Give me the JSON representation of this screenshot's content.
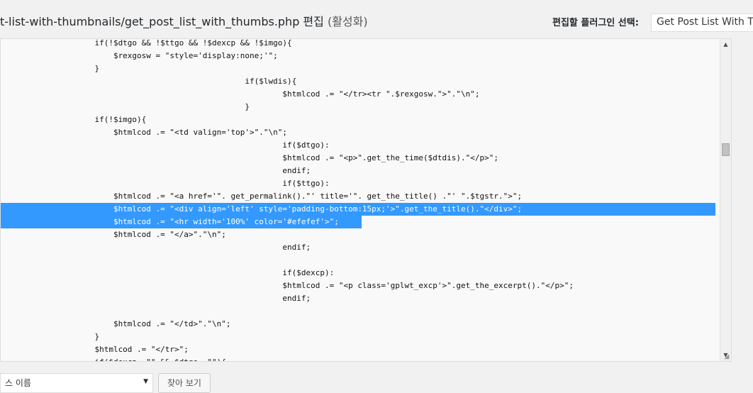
{
  "header": {
    "file_title": "t-list-with-thumbnails/get_post_list_with_thumbs.php 편집",
    "file_status": "(활성화)",
    "plugin_select_label": "편집할 플러그인 선택:",
    "plugin_select_value": "Get Post List With Thumbs"
  },
  "editor": {
    "lines": [
      "                    if(!$dtgo && !$ttgo && !$dexcp && !$imgo){",
      "                        $rexgosw = \"style='display:none;'\";",
      "                    }",
      "                                                    if($lwdis){",
      "                                                            $htmlcod .= \"</tr><tr \".$rexgosw.\">\".\"\\n\";",
      "                                                    }",
      "                    if(!$imgo){",
      "                        $htmlcod .= \"<td valign='top'>\".\"\\n\";",
      "                                                            if($dtgo):",
      "                                                            $htmlcod .= \"<p>\".get_the_time($dtdis).\"</p>\";",
      "                                                            endif;",
      "                                                            if($ttgo):",
      "                        $htmlcod .= \"<a href='\". get_permalink().\"' title='\". get_the_title() .\"' \".$tgstr.\">\";",
      "                        $htmlcod .= \"<div align='left' style='padding-bottom:15px;'>\".get_the_title().\"</div>\";",
      "                        $htmlcod .= \"<hr width='100%' color='#efefef'>\";",
      "                        $htmlcod .= \"</a>\".\"\\n\";",
      "                                                            endif;",
      "",
      "                                                            if($dexcp):",
      "                                                            $htmlcod .= \"<p class='gplwt_excp'>\".get_the_excerpt().\"</p>\";",
      "                                                            endif;",
      "",
      "                        $htmlcod .= \"</td>\".\"\\n\";",
      "                    }",
      "                    $htmlcod .= \"</tr>\";",
      "                    if($dexcp==\"\" && $dtgo==\"\"){"
    ],
    "selected_full_line_index": 13,
    "selected_partial_line_index": 14
  },
  "bottom": {
    "doc_select_value": "스 이름",
    "lookup_button_label": "찾아 보기"
  }
}
